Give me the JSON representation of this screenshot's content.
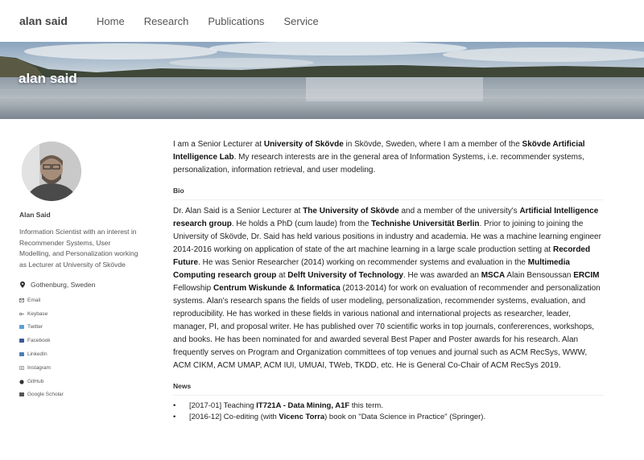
{
  "nav": {
    "brand": "alan said",
    "links": [
      "Home",
      "Research",
      "Publications",
      "Service"
    ]
  },
  "banner": {
    "title": "alan said"
  },
  "sidebar": {
    "name": "Alan Said",
    "bio": "Information Scientist with an interest in Recommender Systems, User Modelling, and Personalization working as Lecturer at University of Skövde",
    "location": "Gothenburg, Sweden",
    "links": [
      {
        "label": "Email",
        "icon": "envelope-icon"
      },
      {
        "label": "Keybase",
        "icon": "key-icon"
      },
      {
        "label": "Twitter",
        "icon": "twitter-icon"
      },
      {
        "label": "Facebook",
        "icon": "facebook-icon"
      },
      {
        "label": "LinkedIn",
        "icon": "linkedin-icon"
      },
      {
        "label": "Instagram",
        "icon": "instagram-icon"
      },
      {
        "label": "GitHub",
        "icon": "github-icon"
      },
      {
        "label": "Google Scholar",
        "icon": "scholar-icon"
      }
    ]
  },
  "main": {
    "intro": [
      {
        "t": "I am a Senior Lecturer at ",
        "b": false
      },
      {
        "t": "University of Skövde",
        "b": true
      },
      {
        "t": " in Skövde, Sweden, where I am a member of the ",
        "b": false
      },
      {
        "t": "Skövde Artificial Intelligence Lab",
        "b": true
      },
      {
        "t": ". My research interests are in the general area of Information Systems, i.e. recommender systems, personalization, information retrieval, and user modeling.",
        "b": false
      }
    ],
    "bio_heading": "Bio",
    "bio": [
      {
        "t": "Dr. Alan Said is a Senior Lecturer at ",
        "b": false
      },
      {
        "t": "The University of Skövde",
        "b": true
      },
      {
        "t": " and a member of the university's ",
        "b": false
      },
      {
        "t": "Artificial Intelligence research group",
        "b": true
      },
      {
        "t": ". He holds a PhD (cum laude) from the ",
        "b": false
      },
      {
        "t": "Technishe Universität Berlin",
        "b": true
      },
      {
        "t": ". Prior to joining to joining the University of Skövde, Dr. Said has held various positions in industry and academia. He was a machine learning engineer 2014-2016 working on application of state of the art machine learning in a large scale production setting at ",
        "b": false
      },
      {
        "t": "Recorded Future",
        "b": true
      },
      {
        "t": ". He was Senior Researcher (2014) working on recommender systems and evaluation in the ",
        "b": false
      },
      {
        "t": "Multimedia Computing research group",
        "b": true
      },
      {
        "t": " at ",
        "b": false
      },
      {
        "t": "Delft University of Technology",
        "b": true
      },
      {
        "t": ". He was awarded an ",
        "b": false
      },
      {
        "t": "MSCA",
        "b": true
      },
      {
        "t": " Alain Bensoussan ",
        "b": false
      },
      {
        "t": "ERCIM",
        "b": true
      },
      {
        "t": " Fellowship ",
        "b": false
      },
      {
        "t": "Centrum Wiskunde & Informatica",
        "b": true
      },
      {
        "t": " (2013-2014) for work on evaluation of recommender and personalization systems. Alan's research spans the fields of user modeling, personalization, recommender systems, evaluation, and reproducibility. He has worked in these fields in various national and international projects as researcher, leader, manager, PI, and proposal writer. He has published over 70 scientific works in top journals, confererences, workshops, and books. He has been nominated for and awarded several Best Paper and Poster awards for his research. Alan frequently serves on Program and Organization committees of top venues and journal such as ACM RecSys, WWW, ACM CIKM, ACM UMAP, ACM IUI, UMUAI, TWeb, TKDD, etc. He is General Co-Chair of ACM RecSys 2019.",
        "b": false
      }
    ],
    "news_heading": "News",
    "news": [
      [
        {
          "t": "[2017-01] Teaching ",
          "b": false
        },
        {
          "t": "IT721A - Data Mining, A1F",
          "b": true
        },
        {
          "t": " this term.",
          "b": false
        }
      ],
      [
        {
          "t": "[2016-12] Co-editing (with ",
          "b": false
        },
        {
          "t": "Vicenc Torra",
          "b": true
        },
        {
          "t": ") book on \"Data Science in Practice\" (Springer).",
          "b": false
        }
      ]
    ]
  },
  "colors": {
    "link_icon": "#5a7fa8",
    "text": "#222222"
  }
}
